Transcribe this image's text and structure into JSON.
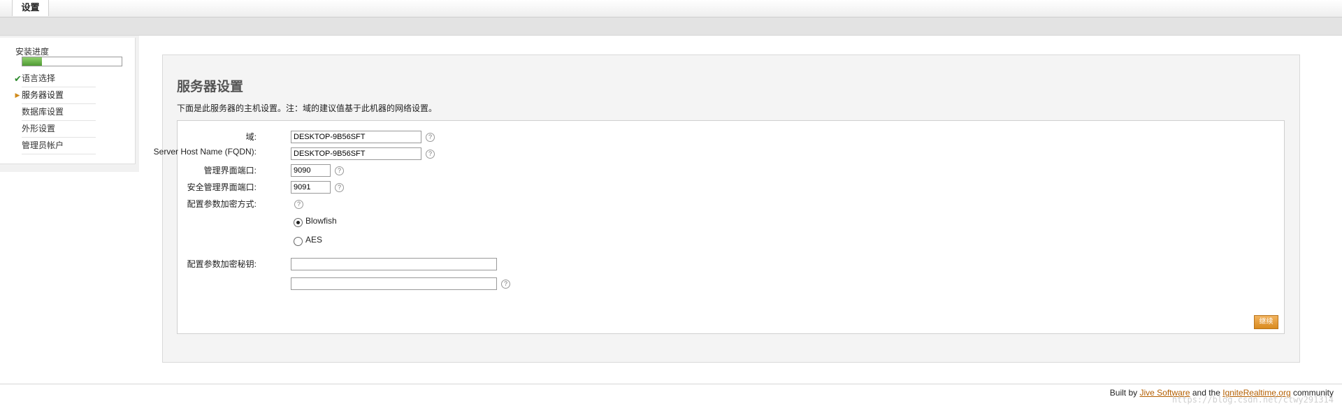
{
  "header": {
    "tab_label": "设置"
  },
  "sidebar": {
    "progress_label": "安装进度",
    "progress": 0.2,
    "steps": [
      {
        "label": "语言选择",
        "state": "done"
      },
      {
        "label": "服务器设置",
        "state": "current"
      },
      {
        "label": "数据库设置",
        "state": "pending"
      },
      {
        "label": "外形设置",
        "state": "pending"
      },
      {
        "label": "管理员帐户",
        "state": "pending"
      }
    ]
  },
  "main": {
    "title": "服务器设置",
    "description": "下面是此服务器的主机设置。注：域的建议值基于此机器的网络设置。",
    "form": {
      "domain": {
        "label": "域:",
        "value": "DESKTOP-9B56SFT"
      },
      "fqdn": {
        "label": "Server Host Name (FQDN):",
        "value": "DESKTOP-9B56SFT"
      },
      "admin_port": {
        "label": "管理界面端口:",
        "value": "9090"
      },
      "secure_admin_port": {
        "label": "安全管理界面端口:",
        "value": "9091"
      },
      "encryption": {
        "label": "配置参数加密方式:",
        "options": [
          {
            "label": "Blowfish",
            "selected": true
          },
          {
            "label": "AES",
            "selected": false
          }
        ]
      },
      "encryption_key": {
        "label": "配置参数加密秘钥:",
        "value": "",
        "confirm_value": ""
      }
    },
    "continue_label": "继续"
  },
  "footer": {
    "prefix": "Built by",
    "link1": "Jive Software",
    "middle": "and the",
    "link2": "IgniteRealtime.org",
    "suffix": "community",
    "watermark": "https://blog.csdn.net/ctwy291314"
  },
  "colors": {
    "accent": "#d98a1e",
    "link": "#b35e00",
    "progress": "#4f9b34"
  }
}
